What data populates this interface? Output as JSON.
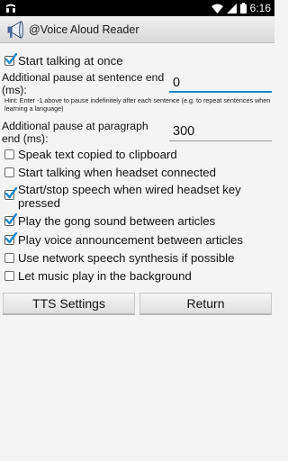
{
  "status_bar": {
    "time": "6:16",
    "icons": [
      "notification-icon",
      "wifi-icon",
      "signal-icon",
      "battery-icon"
    ]
  },
  "app": {
    "title": "@Voice Aloud Reader",
    "icon": "megaphone-icon"
  },
  "settings": {
    "start_talking": {
      "label": "Start talking at once",
      "checked": true
    },
    "sentence_pause": {
      "label": "Additional pause at sentence end (ms):",
      "value": "0",
      "hint": "Hint: Enter -1 above to pause indefinitely after each sentence (e.g. to repeat sentences when learning a language)"
    },
    "paragraph_pause": {
      "label": "Additional pause at paragraph end (ms):",
      "value": "300"
    },
    "options": [
      {
        "label": "Speak text copied to clipboard",
        "checked": false
      },
      {
        "label": "Start talking when headset connected",
        "checked": false
      },
      {
        "label": "Start/stop speech when wired headset key pressed",
        "checked": true
      },
      {
        "label": "Play the gong sound between articles",
        "checked": true
      },
      {
        "label": "Play voice announcement between articles",
        "checked": true
      },
      {
        "label": "Use network speech synthesis if possible",
        "checked": false
      },
      {
        "label": "Let music play in the background",
        "checked": false
      }
    ]
  },
  "buttons": {
    "tts_settings": "TTS Settings",
    "return": "Return"
  },
  "colors": {
    "focus_underline": "#1e88c8",
    "status_bar": "#000000"
  }
}
